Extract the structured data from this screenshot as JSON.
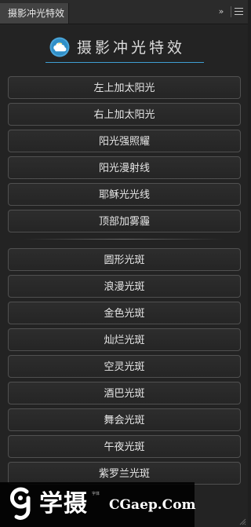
{
  "tab": {
    "title": "摄影冲光特效"
  },
  "tab_controls": {
    "expand_glyph": "»"
  },
  "header": {
    "title": "摄影冲光特效"
  },
  "buttons_group1": [
    "左上加太阳光",
    "右上加太阳光",
    "阳光强照耀",
    "阳光漫射线",
    "耶稣光光线",
    "顶部加雾霾"
  ],
  "buttons_group2": [
    "圆形光斑",
    "浪漫光斑",
    "金色光斑",
    "灿烂光斑",
    "空灵光斑",
    "酒巴光斑",
    "舞会光斑",
    "午夜光斑",
    "紫罗兰光斑"
  ],
  "watermark": {
    "brand": "学摄",
    "vertical_text": "字体",
    "site": "CGaep.Com"
  },
  "colors": {
    "accent": "#3f9fd3",
    "panel_bg": "#232323",
    "button_border": "#505050"
  }
}
